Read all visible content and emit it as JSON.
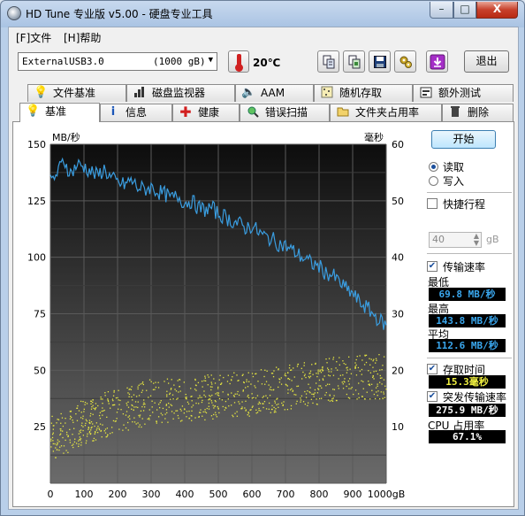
{
  "window": {
    "title": "HD Tune 专业版 v5.00 - 硬盘专业工具",
    "minimize": "–",
    "maximize": "□",
    "close": "X"
  },
  "menu": {
    "file": "[F]文件",
    "help": "[H]帮助"
  },
  "toolbar": {
    "drive": "ExternalUSB3.0",
    "drive_size": "(1000 gB)",
    "temperature": "20℃",
    "exit_label": "退出",
    "buttons": [
      "copy-text-icon",
      "copy-screenshot-icon",
      "save-icon",
      "options-icon",
      "download-icon"
    ]
  },
  "tabs_row1": [
    {
      "label": "文件基准",
      "icon": "file-benchmark-icon"
    },
    {
      "label": "磁盘监视器",
      "icon": "disk-monitor-icon"
    },
    {
      "label": "AAM",
      "icon": "speaker-icon"
    },
    {
      "label": "随机存取",
      "icon": "random-access-icon"
    },
    {
      "label": "额外测试",
      "icon": "extra-tests-icon"
    }
  ],
  "tabs_row2": [
    {
      "label": "基准",
      "icon": "benchmark-icon",
      "active": true
    },
    {
      "label": "信息",
      "icon": "info-icon"
    },
    {
      "label": "健康",
      "icon": "health-icon"
    },
    {
      "label": "错误扫描",
      "icon": "error-scan-icon"
    },
    {
      "label": "文件夹占用率",
      "icon": "folder-usage-icon"
    },
    {
      "label": "删除",
      "icon": "erase-icon"
    }
  ],
  "side": {
    "start": "开始",
    "read": "读取",
    "write": "写入",
    "short_stroke": "快捷行程",
    "short_stroke_value": "40",
    "short_stroke_unit": "gB",
    "transfer_rate": "传输速率",
    "min_label": "最低",
    "min_value": "69.8 MB/秒",
    "max_label": "最高",
    "max_value": "143.8 MB/秒",
    "avg_label": "平均",
    "avg_value": "112.6 MB/秒",
    "access_time": "存取时间",
    "access_value": "15.3毫秒",
    "burst_rate": "突发传输速率",
    "burst_value": "275.9 MB/秒",
    "cpu_label": "CPU 占用率",
    "cpu_value": "67.1%"
  },
  "chart_data": {
    "type": "line",
    "ylabel_left": "MB/秒",
    "ylabel_right": "毫秒",
    "xlabel_suffix": "gB",
    "x_ticks": [
      "0",
      "100",
      "200",
      "300",
      "400",
      "500",
      "600",
      "700",
      "800",
      "900",
      "1000gB"
    ],
    "y_ticks_left": [
      "25",
      "50",
      "75",
      "100",
      "125",
      "150"
    ],
    "y_ticks_right": [
      "10",
      "20",
      "30",
      "40",
      "50",
      "60"
    ],
    "xlim": [
      0,
      1000
    ],
    "ylim_left": [
      0,
      150
    ],
    "ylim_right": [
      0,
      60
    ],
    "grid": true,
    "series": [
      {
        "name": "传输速率",
        "color": "#3a9de0",
        "x": [
          0,
          20,
          40,
          60,
          80,
          100,
          120,
          140,
          160,
          180,
          200,
          220,
          240,
          260,
          280,
          300,
          320,
          340,
          360,
          380,
          400,
          420,
          440,
          460,
          480,
          500,
          520,
          540,
          560,
          580,
          600,
          620,
          640,
          660,
          680,
          700,
          720,
          740,
          760,
          780,
          800,
          820,
          840,
          860,
          880,
          900,
          920,
          940,
          960,
          980,
          1000
        ],
        "values": [
          133,
          137,
          143,
          137,
          141,
          140,
          138,
          136,
          139,
          135,
          133,
          132,
          134,
          131,
          130,
          131,
          129,
          128,
          126,
          127,
          124,
          125,
          122,
          121,
          122,
          119,
          118,
          116,
          115,
          113,
          114,
          111,
          109,
          108,
          106,
          105,
          103,
          101,
          99,
          97,
          96,
          93,
          92,
          89,
          86,
          84,
          80,
          78,
          75,
          72,
          70
        ]
      },
      {
        "name": "存取时间",
        "color": "#e8e840",
        "x": [
          0,
          100,
          200,
          300,
          400,
          500,
          600,
          700,
          800,
          900,
          1000
        ],
        "values": [
          8,
          11,
          13,
          14.5,
          15,
          15.5,
          16,
          17,
          18,
          19,
          19
        ]
      }
    ],
    "access_time_spread_ms": 4
  }
}
